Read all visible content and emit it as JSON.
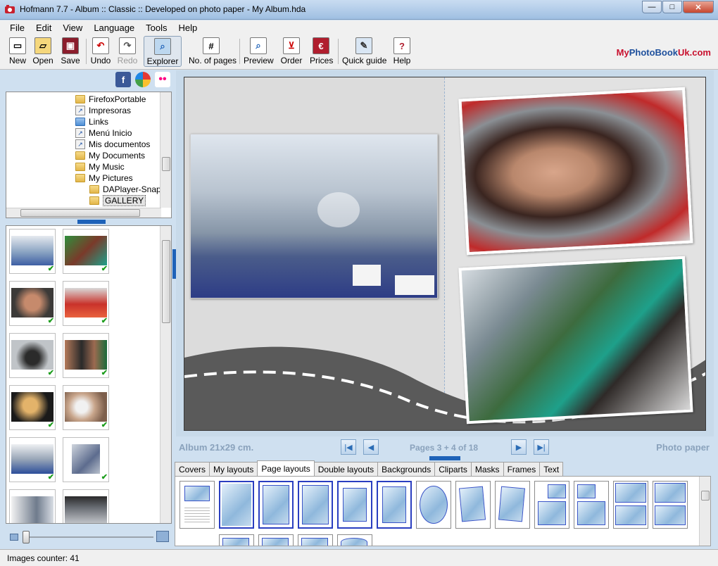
{
  "window": {
    "title": "Hofmann 7.7   -  Album :: Classic :: Developed on photo paper   -  My Album.hda",
    "buttons": {
      "minimize": "—",
      "maximize": "□",
      "close": "✕"
    }
  },
  "menu": [
    "File",
    "Edit",
    "View",
    "Language",
    "Tools",
    "Help"
  ],
  "toolbar": {
    "new": "New",
    "open": "Open",
    "save": "Save",
    "undo": "Undo",
    "redo": "Redo",
    "explorer": "Explorer",
    "pages": "No. of pages",
    "preview": "Preview",
    "order": "Order",
    "prices": "Prices",
    "quick_guide": "Quick guide",
    "help": "Help"
  },
  "brand": {
    "prefix": "My",
    "name": "PhotoBook",
    "suffix": "Uk.com"
  },
  "social": {
    "facebook": "f",
    "picasa": "",
    "flickr": "••"
  },
  "tree": {
    "items": [
      "FirefoxPortable",
      "Impresoras",
      "Links",
      "Menú Inicio",
      "Mis documentos",
      "My Documents",
      "My Music",
      "My Pictures",
      "DAPlayer-Snapsh",
      "GALLERY"
    ]
  },
  "album": {
    "size_label": "Album 21x29 cm.",
    "pages_label": "Pages 3 + 4 of 18",
    "paper_label": "Photo paper"
  },
  "tabs": [
    "Covers",
    "My layouts",
    "Page layouts",
    "Double layouts",
    "Backgrounds",
    "Cliparts",
    "Masks",
    "Frames",
    "Text"
  ],
  "status": {
    "counter": "Images counter: 41"
  },
  "colors": {
    "accent": "#1e62b8",
    "selection": "#2a3ec0"
  }
}
